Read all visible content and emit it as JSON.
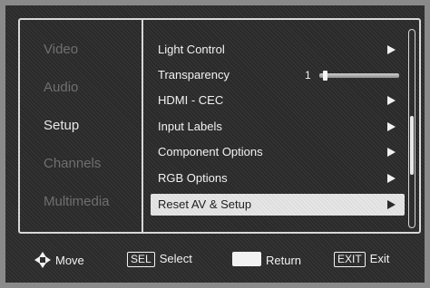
{
  "menu": {
    "categories": [
      {
        "label": "Video",
        "active": false
      },
      {
        "label": "Audio",
        "active": false
      },
      {
        "label": "Setup",
        "active": true
      },
      {
        "label": "Channels",
        "active": false
      },
      {
        "label": "Multimedia",
        "active": false
      }
    ],
    "items": [
      {
        "label": "Light Control",
        "type": "submenu",
        "selected": false
      },
      {
        "label": "Transparency",
        "type": "slider",
        "value": "1",
        "level": 0.05,
        "selected": false
      },
      {
        "label": "HDMI - CEC",
        "type": "submenu",
        "selected": false
      },
      {
        "label": "Input Labels",
        "type": "submenu",
        "selected": false
      },
      {
        "label": "Component Options",
        "type": "submenu",
        "selected": false
      },
      {
        "label": "RGB Options",
        "type": "submenu",
        "selected": false
      },
      {
        "label": "Reset AV & Setup",
        "type": "submenu",
        "selected": true
      }
    ],
    "scroll": {
      "position": 0.62,
      "size": 0.3
    }
  },
  "bottom_bar": {
    "move": {
      "icon": "four-way-arrow-icon",
      "label": "Move"
    },
    "select": {
      "key": "SEL",
      "label": "Select"
    },
    "return": {
      "icon": "blank-key-icon",
      "label": "Return"
    },
    "exit": {
      "key": "EXIT",
      "label": "Exit"
    }
  },
  "colors": {
    "background": "#2b2b2b",
    "text": "#f2f2f2",
    "inactive_text": "#6f6f6f",
    "highlight": "#e6e6e6"
  }
}
